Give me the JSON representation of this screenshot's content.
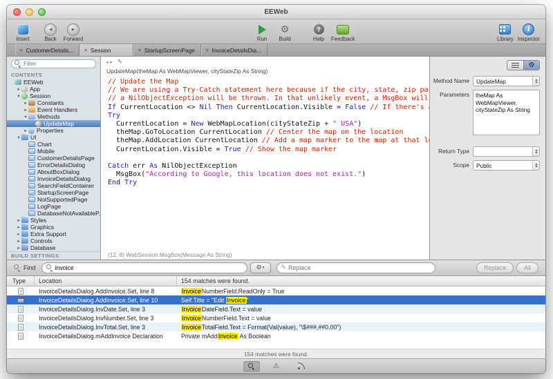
{
  "window": {
    "title": "EEWeb"
  },
  "toolbar": {
    "items": [
      {
        "id": "insert",
        "label": "Insert",
        "icon": "insert-cube-icon"
      },
      {
        "id": "back",
        "label": "Back",
        "icon": "back-arrow-icon"
      },
      {
        "id": "forward",
        "label": "Forward",
        "icon": "forward-arrow-icon"
      },
      {
        "id": "run",
        "label": "Run",
        "icon": "run-play-icon"
      },
      {
        "id": "build",
        "label": "Build",
        "icon": "build-gear-icon"
      },
      {
        "id": "help",
        "label": "Help",
        "icon": "help-icon"
      },
      {
        "id": "feedback",
        "label": "Feedback",
        "icon": "feedback-bubble-icon"
      },
      {
        "id": "library",
        "label": "Library",
        "icon": "library-icon"
      },
      {
        "id": "inspector",
        "label": "Inspector",
        "icon": "inspector-info-icon"
      }
    ]
  },
  "tabs": [
    {
      "label": "CustomerDetails...",
      "active": false
    },
    {
      "label": "Session",
      "active": true
    },
    {
      "label": "StartupScreenPage",
      "active": false
    },
    {
      "label": "InvoiceDetailsDia...",
      "active": false
    }
  ],
  "sidebar": {
    "filter_placeholder": "Filter",
    "contents_label": "CONTENTS",
    "build_settings_label": "BUILD SETTINGS",
    "tree": [
      {
        "label": "EEWeb",
        "depth": 0,
        "disclosure": "none",
        "icon": "project",
        "selected": false
      },
      {
        "label": "App",
        "depth": 1,
        "disclosure": "closed",
        "icon": "app",
        "selected": false
      },
      {
        "label": "Session",
        "depth": 1,
        "disclosure": "open",
        "icon": "session",
        "selected": false
      },
      {
        "label": "Constants",
        "depth": 2,
        "disclosure": "closed",
        "icon": "constants",
        "selected": false
      },
      {
        "label": "Event Handlers",
        "depth": 2,
        "disclosure": "closed",
        "icon": "events",
        "selected": false
      },
      {
        "label": "Methods",
        "depth": 2,
        "disclosure": "open",
        "icon": "methods",
        "selected": false
      },
      {
        "label": "UpdateMap",
        "depth": 3,
        "disclosure": "none",
        "icon": "method",
        "selected": true
      },
      {
        "label": "Properties",
        "depth": 2,
        "disclosure": "closed",
        "icon": "props",
        "selected": false
      },
      {
        "label": "UI",
        "depth": 1,
        "disclosure": "open",
        "icon": "folder",
        "selected": false
      },
      {
        "label": "Chart",
        "depth": 2,
        "disclosure": "none",
        "icon": "page",
        "selected": false
      },
      {
        "label": "Mobile",
        "depth": 2,
        "disclosure": "none",
        "icon": "page",
        "selected": false
      },
      {
        "label": "CustomerDetailsPage",
        "depth": 2,
        "disclosure": "none",
        "icon": "page",
        "selected": false
      },
      {
        "label": "ErrorDetailsDialog",
        "depth": 2,
        "disclosure": "none",
        "icon": "page",
        "selected": false
      },
      {
        "label": "AboutBoxDialog",
        "depth": 2,
        "disclosure": "none",
        "icon": "page",
        "selected": false
      },
      {
        "label": "InvoiceDetailsDialog",
        "depth": 2,
        "disclosure": "none",
        "icon": "page",
        "selected": false
      },
      {
        "label": "SearchFieldContainer",
        "depth": 2,
        "disclosure": "none",
        "icon": "page",
        "selected": false
      },
      {
        "label": "StartupScreenPage",
        "depth": 2,
        "disclosure": "none",
        "icon": "page",
        "selected": false
      },
      {
        "label": "NotSupportedPage",
        "depth": 2,
        "disclosure": "none",
        "icon": "page",
        "selected": false
      },
      {
        "label": "LogPage",
        "depth": 2,
        "disclosure": "none",
        "icon": "page",
        "selected": false
      },
      {
        "label": "DatabaseNotAvailableP...",
        "depth": 2,
        "disclosure": "none",
        "icon": "page",
        "selected": false
      },
      {
        "label": "Styles",
        "depth": 1,
        "disclosure": "closed",
        "icon": "folder",
        "selected": false
      },
      {
        "label": "Graphics",
        "depth": 1,
        "disclosure": "closed",
        "icon": "folder",
        "selected": false
      },
      {
        "label": "Extra Support",
        "depth": 1,
        "disclosure": "closed",
        "icon": "folder",
        "selected": false
      },
      {
        "label": "Controls",
        "depth": 1,
        "disclosure": "closed",
        "icon": "folder",
        "selected": false
      },
      {
        "label": "Database",
        "depth": 1,
        "disclosure": "closed",
        "icon": "folder",
        "selected": false
      }
    ]
  },
  "editor": {
    "signature": "UpdateMap(theMap As WebMapViewer, cityStateZip As String)",
    "status": "(12, 8) WebSession.MsgBox(Message As String)",
    "lines": [
      [
        {
          "t": "// Update the Map",
          "c": "comment"
        }
      ],
      [
        {
          "t": "// We are using a Try-Catch statement here because if the city, state, zip pas",
          "c": "comment"
        }
      ],
      [
        {
          "t": "// a NilObjectException will be thrown. In that unlikely event, a MsgBox will",
          "c": "comment"
        }
      ],
      [
        {
          "t": "If",
          "c": "keyword"
        },
        {
          "t": " CurrentLocation <> ",
          "c": "plain"
        },
        {
          "t": "Nil",
          "c": "keyword"
        },
        {
          "t": " ",
          "c": "plain"
        },
        {
          "t": "Then",
          "c": "keyword"
        },
        {
          "t": " CurrentLocation.Visible = ",
          "c": "plain"
        },
        {
          "t": "False",
          "c": "keyword"
        },
        {
          "t": " ",
          "c": "plain"
        },
        {
          "t": "// If there's a",
          "c": "comment"
        }
      ],
      [
        {
          "t": "Try",
          "c": "keyword"
        }
      ],
      [
        {
          "t": "  CurrentLocation = ",
          "c": "plain"
        },
        {
          "t": "New",
          "c": "keyword"
        },
        {
          "t": " WebMapLocation(cityStateZip + ",
          "c": "plain"
        },
        {
          "t": "\" USA\"",
          "c": "string"
        },
        {
          "t": ")",
          "c": "plain"
        }
      ],
      [
        {
          "t": "  theMap.GoToLocation CurrentLocation ",
          "c": "plain"
        },
        {
          "t": "// Center the map on the location",
          "c": "comment"
        }
      ],
      [
        {
          "t": "  theMap.AddLocation CurrentLocation ",
          "c": "plain"
        },
        {
          "t": "// Add a map marker to the map at that lo",
          "c": "comment"
        }
      ],
      [
        {
          "t": "  CurrentLocation.Visible = ",
          "c": "plain"
        },
        {
          "t": "True",
          "c": "keyword"
        },
        {
          "t": " ",
          "c": "plain"
        },
        {
          "t": "// Show the map marker",
          "c": "comment"
        }
      ],
      [],
      [
        {
          "t": "Catch",
          "c": "keyword"
        },
        {
          "t": " err ",
          "c": "plain"
        },
        {
          "t": "As",
          "c": "keyword"
        },
        {
          "t": " NilObjectException",
          "c": "plain"
        }
      ],
      [
        {
          "t": "  MsgBox(",
          "c": "plain"
        },
        {
          "t": "\"According to Google, this location does not exist.\"",
          "c": "string"
        },
        {
          "t": ")",
          "c": "plain"
        }
      ],
      [
        {
          "t": "End Try",
          "c": "keyword"
        }
      ]
    ]
  },
  "inspector": {
    "method_name_label": "Method Name",
    "method_name_value": "UpdateMap",
    "parameters_label": "Parameters",
    "parameters_value": "theMap As WebMapViewer, cityStateZip As String",
    "return_type_label": "Return Type",
    "return_type_value": "",
    "scope_label": "Scope",
    "scope_value": "Public"
  },
  "find": {
    "find_label": "Find",
    "search_value": "invoice",
    "replace_placeholder": "Replace",
    "replace_button_label": "Replace",
    "all_button_label": "All",
    "header": {
      "type": "Type",
      "location": "Location",
      "matches": "154 matches were found."
    },
    "status": "154 matches were found.",
    "results": [
      {
        "icon": "code-file",
        "selected": false,
        "location": "InvoiceDetailsDialog.AddInvoice.Set, line 8",
        "segments": [
          {
            "t": "Invoice",
            "h": true
          },
          {
            "t": "NumberField.ReadOnly = True",
            "h": false
          }
        ]
      },
      {
        "icon": "window-file",
        "selected": true,
        "location": "InvoiceDetailsDialog.AddInvoice.Set, line 10",
        "segments": [
          {
            "t": "Self.Title = \"Edit ",
            "h": false
          },
          {
            "t": "Invoice",
            "h": true
          },
          {
            "t": "\"",
            "h": false
          }
        ]
      },
      {
        "icon": "code-file",
        "selected": false,
        "location": "InvoiceDetailsDialog.InvDate.Set, line 3",
        "segments": [
          {
            "t": "Invoice",
            "h": true
          },
          {
            "t": "DateField.Text = value",
            "h": false
          }
        ]
      },
      {
        "icon": "code-file",
        "selected": false,
        "location": "InvoiceDetailsDialog.InvNumber.Set, line 3",
        "segments": [
          {
            "t": "Invoice",
            "h": true
          },
          {
            "t": "NumberField.Text = value",
            "h": false
          }
        ]
      },
      {
        "icon": "code-file",
        "selected": false,
        "location": "InvoiceDetailsDialog.InvTotal.Set, line 3",
        "segments": [
          {
            "t": "Invoice",
            "h": true
          },
          {
            "t": "TotalField.Text = Format(Val(value), \"\\$###,##0.00\")",
            "h": false
          }
        ]
      },
      {
        "icon": "code-file",
        "selected": false,
        "location": "InvoiceDetailsDialog.mAddInvoice Declaration",
        "segments": [
          {
            "t": "Private mAdd",
            "h": false
          },
          {
            "t": "Invoice",
            "h": true
          },
          {
            "t": " As Boolean",
            "h": false
          }
        ]
      }
    ]
  }
}
